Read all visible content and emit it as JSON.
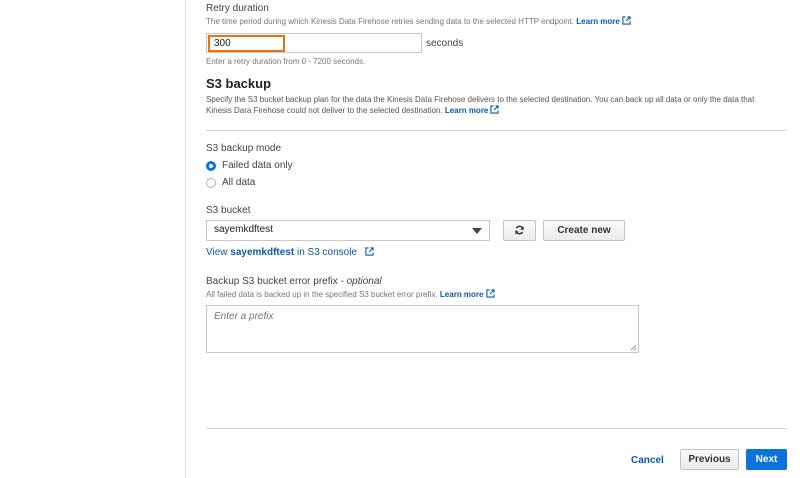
{
  "retry": {
    "label": "Retry duration",
    "description": "The time period during which Kinesis Data Firehose retries sending data to the selected HTTP endpoint.",
    "learn_more": "Learn more",
    "value": "300",
    "unit": "seconds",
    "hint": "Enter a retry duration from 0 - 7200 seconds."
  },
  "s3_backup": {
    "heading": "S3 backup",
    "description_line1": "Specify the S3 bucket backup plan for the data the Kinesis Data Firehose delivers to the selected destination. You can back up all data or only the data that",
    "description_line2": "Kinesis Dara Firehose could not deliver to the selected destination.",
    "learn_more": "Learn more"
  },
  "backup_mode": {
    "label": "S3 backup mode",
    "options": [
      {
        "label": "Failed data only",
        "selected": true
      },
      {
        "label": "All data",
        "selected": false
      }
    ]
  },
  "bucket": {
    "label": "S3 bucket",
    "selected": "sayemkdftest",
    "create_new": "Create new",
    "view_prefix": "View",
    "view_bucket": "sayemkdftest",
    "view_suffix": "in S3 console"
  },
  "error_prefix": {
    "label": "Backup S3 bucket error prefix",
    "optional": " - optional",
    "description": "All failed data is backed up in the specified S3 bucket error prefix.",
    "learn_more": "Learn more",
    "placeholder": "Enter a prefix"
  },
  "footer": {
    "cancel": "Cancel",
    "previous": "Previous",
    "next": "Next"
  },
  "colors": {
    "link": "#0b5aa8",
    "accent": "#0b73d9",
    "focus": "#ec7211"
  }
}
